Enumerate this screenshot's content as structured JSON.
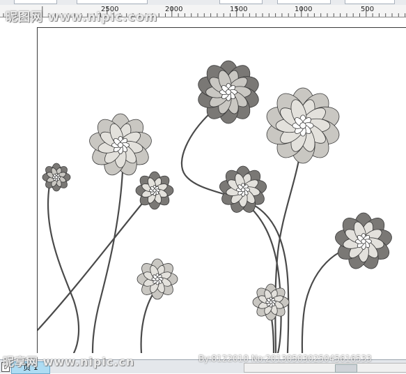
{
  "ruler": {
    "ticks": [
      {
        "label": "2500",
        "pos": 155
      },
      {
        "label": "2000",
        "pos": 247
      },
      {
        "label": "1500",
        "pos": 340
      },
      {
        "label": "1000",
        "pos": 433
      },
      {
        "label": "500",
        "pos": 525
      }
    ]
  },
  "statusbar": {
    "page_tab": "页 1",
    "scroll_marker": "III"
  },
  "watermark": {
    "top": "昵图网 www.nipic.com",
    "bottom": "昵享网 www.nipic.cn",
    "code": "By:8122010 No:20130503025045616533"
  },
  "colors": {
    "petal_dark": "#7a7875",
    "petal_light": "#c9c7c2",
    "petal_pale": "#e3e1dc",
    "stem": "#4a4a4a",
    "outline": "#3a3a3a"
  },
  "icons": {
    "page_nav": "page-icon"
  }
}
